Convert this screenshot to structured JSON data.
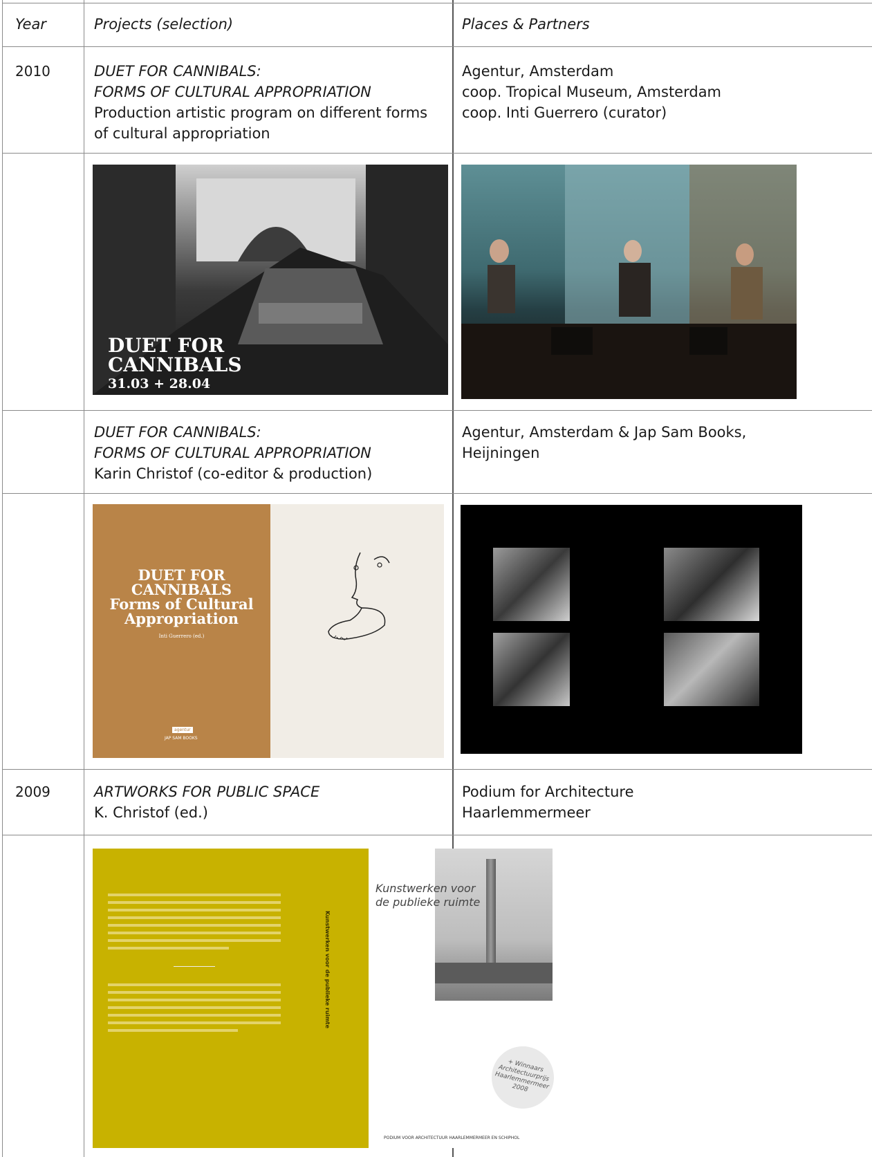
{
  "headers": {
    "year": "Year",
    "projects": "Projects (selection)",
    "places": "Places & Partners"
  },
  "rows": {
    "r2010": {
      "year": "2010",
      "title1": "DUET FOR CANNIBALS:",
      "title2": "FORMS OF CULTURAL APPROPRIATION",
      "desc1": "Production artistic program on different forms",
      "desc2": "of cultural appropriation",
      "place1": "Agentur, Amsterdam",
      "place2": "coop. Tropical Museum, Amsterdam",
      "place3": "coop. Inti Guerrero (curator)"
    },
    "book": {
      "title1": "DUET FOR CANNIBALS:",
      "title2": "FORMS OF CULTURAL APPROPRIATION",
      "desc": "Karin Christof (co-editor & production)",
      "place1": "Agentur, Amsterdam & Jap Sam Books,",
      "place2": "Heijningen"
    },
    "r2009": {
      "year": "2009",
      "title": "ARTWORKS FOR PUBLIC SPACE",
      "desc": "K. Christof (ed.)",
      "place1": "Podium for Architecture",
      "place2": "Haarlemmermeer"
    }
  },
  "images": {
    "poster1": {
      "line1": "DUET FOR",
      "line2": "CANNIBALS",
      "line3": "31.03 + 28.04"
    },
    "bookcover": {
      "line1": "DUET FOR",
      "line2": "CANNIBALS",
      "line3": "Forms of Cultural",
      "line4": "Appropriation",
      "editor": "Inti Guerrero (ed.)",
      "publisher": "JAP SAM BOOKS",
      "logo": "agentur"
    },
    "public_space": {
      "title1": "Kunstwerken voor",
      "title2": "de publieke ruimte",
      "stamp": "+ Winnaars Architectuurprijs Haarlemmermeer 2008",
      "footer": "PODIUM VOOR ARCHITECTUUR HAARLEMMERMEER EN SCHIPHOL",
      "spine": "Kunstwerken voor de publieke ruimte"
    }
  },
  "colors": {
    "brown_cover": "#b98448",
    "yellow_cover": "#c8b200",
    "grid": "#8a8a8a"
  }
}
